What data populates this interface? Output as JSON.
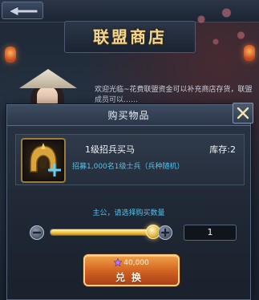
{
  "shop": {
    "title": "联盟商店",
    "npc_speech": "欢迎光临~花费联盟资金可以补充商店存货，联盟成员可以……"
  },
  "dialog": {
    "title": "购买物品",
    "item": {
      "name": "1级招兵买马",
      "stock_label": "库存:2",
      "description": "招募1,000名1级士兵（兵种随机）",
      "icon": "golden-helmet-icon"
    },
    "prompt": "主公，请选择购买数量",
    "quantity": {
      "value": "1",
      "slider_fraction": 1.0
    },
    "exchange_button": {
      "cost": "40,000",
      "currency_icon": "purple-star-icon",
      "label": "兑换"
    }
  },
  "colors": {
    "accent_blue": "#4fc3ee",
    "title_gold": "#f1d58e",
    "button_orange": "#d0601f"
  }
}
